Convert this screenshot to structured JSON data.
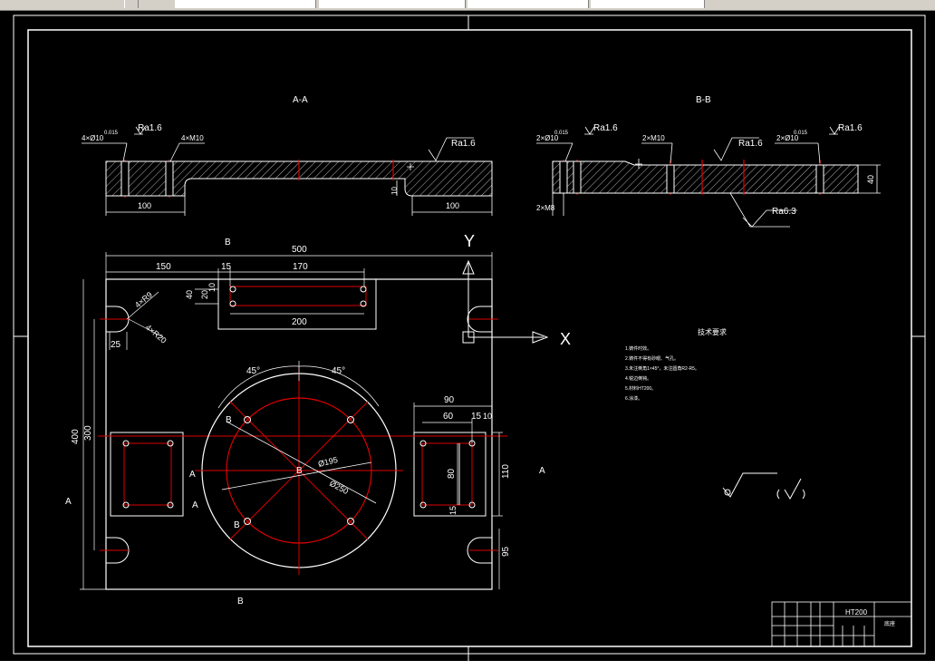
{
  "toolbar": {
    "tabs": [
      "",
      "",
      "",
      ""
    ]
  },
  "drawing": {
    "section_aa_label": "A-A",
    "section_bb_label": "B-B",
    "surface_finish": [
      "Ra1.6",
      "Ra1.6",
      "Ra1.6",
      "Ra1.6",
      "Ra1.6",
      "Ra6.3"
    ],
    "callouts_aa": [
      "4×Ø10",
      "4×M10",
      "0.015"
    ],
    "callouts_bb": [
      "2×Ø10",
      "2×M10",
      "2×Ø10",
      "2×M8",
      "0.015",
      "0.015"
    ],
    "dims_aa": [
      "100",
      "100",
      "10"
    ],
    "dim_bb_height": "40",
    "axis_y": "Y",
    "axis_x": "X",
    "plan_dims": [
      "500",
      "150",
      "15",
      "170",
      "40",
      "20",
      "10",
      "200",
      "25",
      "400",
      "300",
      "90",
      "60",
      "15",
      "10",
      "80",
      "110",
      "15",
      "95"
    ],
    "angle_labels": [
      "45°",
      "45°"
    ],
    "radius_labels": [
      "4×R9",
      "4×R20"
    ],
    "diameter_labels": [
      "Ø195",
      "Ø250"
    ],
    "section_marks": [
      "B",
      "B",
      "B",
      "A",
      "A",
      "A",
      "A",
      "B",
      "B"
    ],
    "notes_title": "技术要求",
    "notes": [
      "1.铸件时效。",
      "2.铸件不得有砂眼、气孔。",
      "3.未注倒角1×45°，未注圆角R2-R5。",
      "4.锐边倒钝。",
      "5.材料HT200。",
      "6.涂漆。"
    ],
    "title_material": "HT200",
    "title_name": "底座"
  },
  "status": {
    "text": ""
  }
}
